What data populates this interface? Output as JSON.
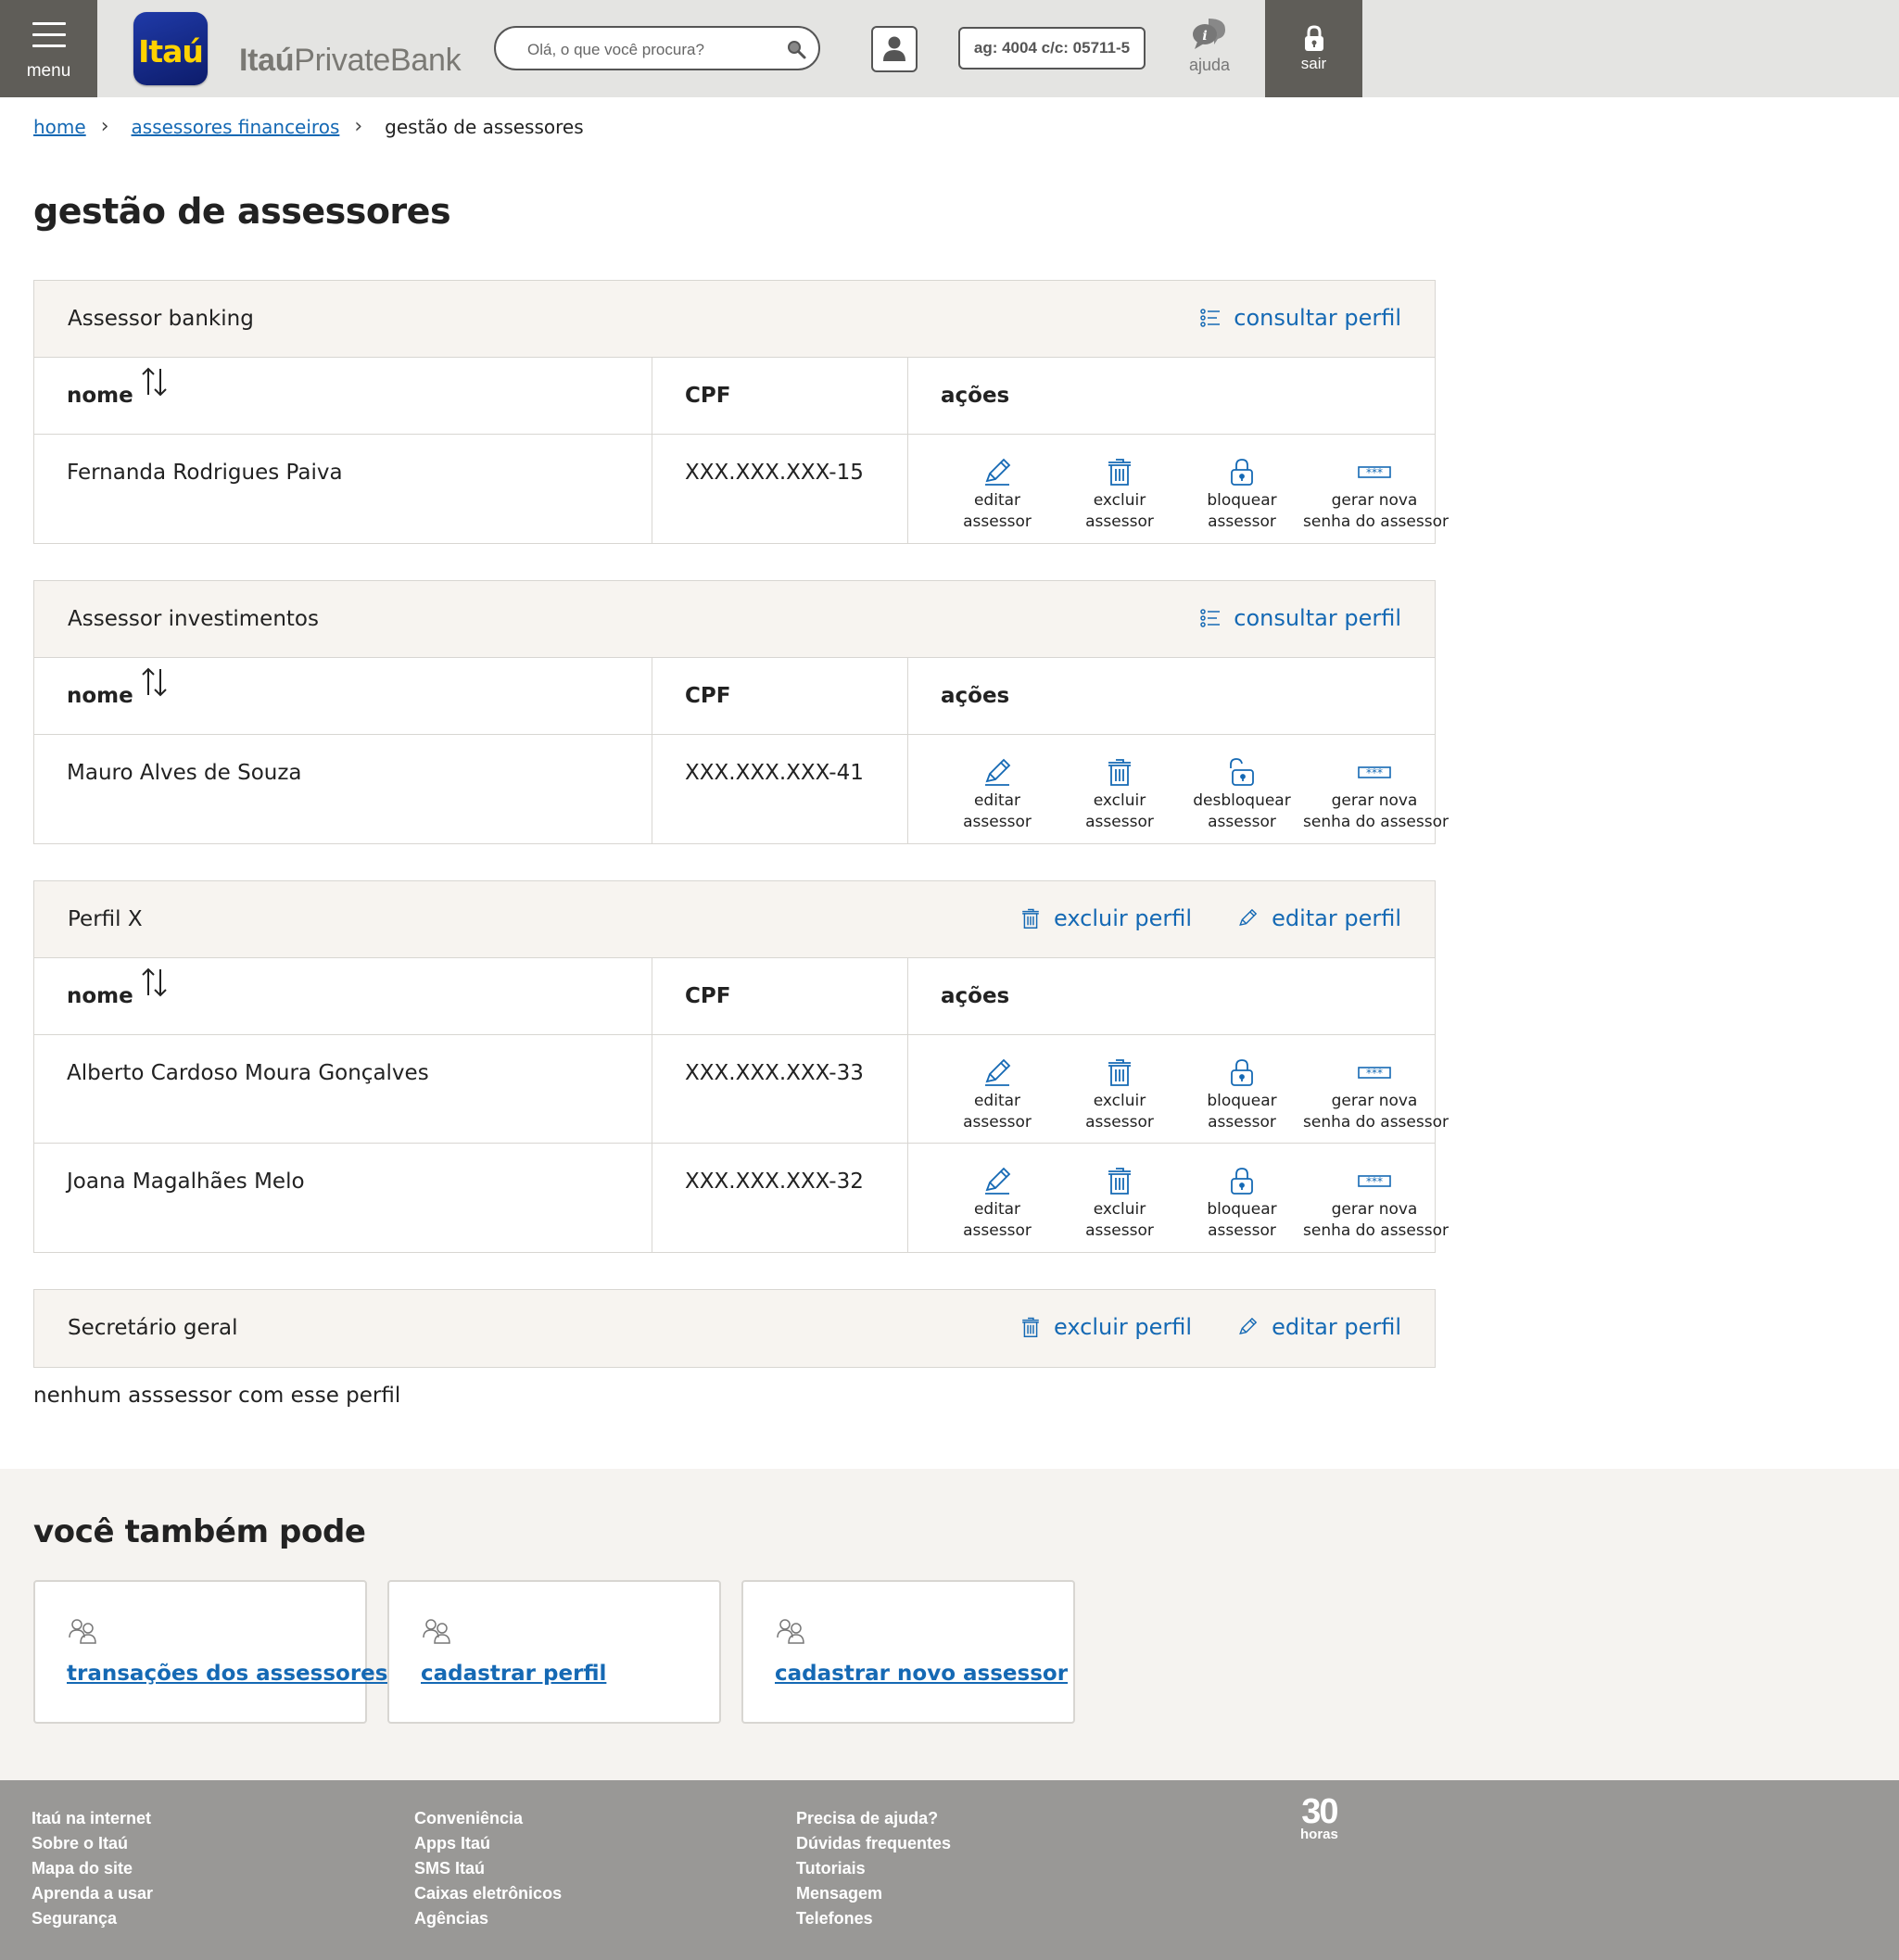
{
  "header": {
    "menu_label": "menu",
    "logo_text": "Itaú",
    "brand_bold": "Itaú",
    "brand_rest": "PrivateBank",
    "search_placeholder": "Olá, o que você procura?",
    "account": "ag: 4004 c/c: 05711-5",
    "help_label": "ajuda",
    "exit_label": "sair"
  },
  "breadcrumb": {
    "home": "home",
    "parent": "assessores financeiros",
    "current": "gestão de assessores"
  },
  "page_title": "gestão de assessores",
  "table_headers": {
    "name": "nome",
    "cpf": "CPF",
    "actions": "ações"
  },
  "action_labels": {
    "edit": [
      "editar",
      "assessor"
    ],
    "delete": [
      "excluir",
      "assessor"
    ],
    "block": [
      "bloquear",
      "assessor"
    ],
    "unblock": [
      "desbloquear",
      "assessor"
    ],
    "password": [
      "gerar nova",
      "senha do assessor"
    ]
  },
  "group_actions": {
    "consult": "consultar perfil",
    "delete_profile": "excluir perfil",
    "edit_profile": "editar perfil"
  },
  "groups": [
    {
      "title": "Assessor banking",
      "rows": [
        {
          "name": "Fernanda Rodrigues Paiva",
          "cpf": "XXX.XXX.XXX-15",
          "status": "active"
        }
      ]
    },
    {
      "title": "Assessor investimentos",
      "rows": [
        {
          "name": "Mauro Alves de Souza",
          "cpf": "XXX.XXX.XXX-41",
          "status": "blocked"
        }
      ]
    },
    {
      "title": "Perfil X",
      "rows": [
        {
          "name": "Alberto Cardoso Moura Gonçalves",
          "cpf": "XXX.XXX.XXX-33",
          "status": "active"
        },
        {
          "name": "Joana Magalhães Melo",
          "cpf": "XXX.XXX.XXX-32",
          "status": "active"
        }
      ]
    },
    {
      "title": "Secretário geral",
      "rows": []
    }
  ],
  "empty_message": "nenhum asssessor com esse perfil",
  "also": {
    "title": "você também pode",
    "cards": [
      "transações dos assessores",
      "cadastrar perfil",
      "cadastrar novo assessor"
    ]
  },
  "footer": {
    "col1": [
      "Itaú na internet",
      "Sobre o Itaú",
      "Mapa do site",
      "Aprenda a usar",
      "Segurança"
    ],
    "col2": [
      "Conveniência",
      "Apps Itaú",
      "SMS Itaú",
      "Caixas eletrônicos",
      "Agências"
    ],
    "col3": [
      "Precisa de ajuda?",
      "Dúvidas frequentes",
      "Tutoriais",
      "Mensagem",
      "Telefones"
    ],
    "badge_number": "30",
    "badge_text": "horas"
  },
  "colors": {
    "link": "#1569b4",
    "dark": "#5f5d58",
    "header_bg": "#e4e4e2",
    "card_head": "#f7f4f0",
    "footer": "#999896",
    "logo_yellow": "#ffd200"
  },
  "icons": [
    "menu-icon",
    "search-icon",
    "user-icon",
    "help-icon",
    "lock-icon",
    "sort-icon",
    "list-icon",
    "pencil-icon",
    "trash-icon",
    "padlock-icon",
    "unlock-icon",
    "password-icon",
    "people-icon"
  ]
}
